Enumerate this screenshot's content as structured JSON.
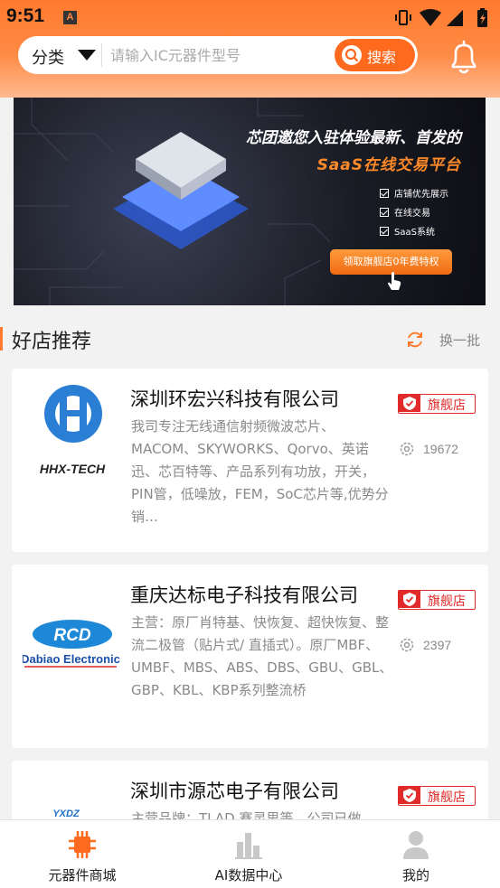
{
  "status_bar": {
    "time": "9:51",
    "notif_letter": "A"
  },
  "search": {
    "category_label": "分类",
    "placeholder": "请输入IC元器件型号",
    "button_label": "搜索"
  },
  "banner": {
    "title": "芯团邀您入驻体验最新、首发的",
    "subtitle": "SaaS在线交易平台",
    "features": [
      "店铺优先展示",
      "在线交易",
      "SaaS系统"
    ],
    "cta": "领取旗舰店0年费特权"
  },
  "section": {
    "title": "好店推荐",
    "refresh_label": "换一批"
  },
  "shops": [
    {
      "name": "深圳环宏兴科技有限公司",
      "desc": "我司专注无线通信射频微波芯片、MACOM、SKYWORKS、Qorvo、英诺迅、芯百特等、产品系列有功放，开关，PIN管，低噪放，FEM，SoC芯片等,优势分销…",
      "badge": "旗舰店",
      "views": "19672",
      "logo_text": "HHX-TECH"
    },
    {
      "name": "重庆达标电子科技有限公司",
      "desc": "主营：原厂肖特基、快恢复、超快恢复、整流二极管（贴片式/ 直插式）。原厂MBF、UMBF、MBS、ABS、DBS、GBU、GBL、GBP、KBL、KBP系列整流桥",
      "badge": "旗舰店",
      "views": "2397",
      "logo_text": "Dabiao Electronic",
      "logo_mark": "RCD"
    },
    {
      "name": "深圳市源芯电子有限公司",
      "desc": "主营品牌：TLAD 赛灵思等，公司已做",
      "badge": "旗舰店",
      "logo_text": "YXDZ"
    }
  ],
  "tabbar": [
    {
      "label": "元器件商城",
      "icon": "chip-icon",
      "color": "#ff6a1f",
      "active": true
    },
    {
      "label": "AI数据中心",
      "icon": "bar-chart-icon",
      "color": "#c8c8c8",
      "active": false
    },
    {
      "label": "我的",
      "icon": "person-icon",
      "color": "#c8c8c8",
      "active": false
    }
  ],
  "colors": {
    "accent": "#ff6a1f",
    "badge_red": "#e12a2a",
    "header_gradient_top": "#ff7a2e"
  }
}
